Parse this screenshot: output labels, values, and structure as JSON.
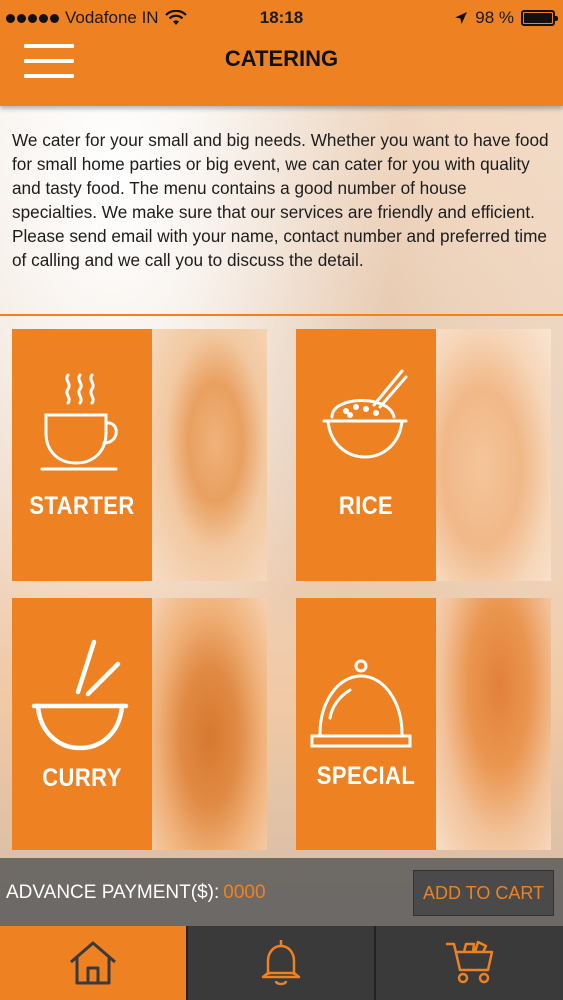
{
  "status_bar": {
    "carrier": "Vodafone IN",
    "time": "18:18",
    "battery": "98 %"
  },
  "header": {
    "title": "CATERING",
    "menu_icon": "hamburger-icon"
  },
  "intro_text": "We cater for your small and big needs. Whether you want to have food for small home parties or big event, we can cater for you with quality and tasty food. The menu contains a good number of house specialties. We make sure that our services are friendly and efficient. Please send email with your name, contact number and preferred time of calling and we call you to discuss the detail.",
  "categories": [
    {
      "label": "STARTER",
      "icon": "coffee-cup-icon"
    },
    {
      "label": "RICE",
      "icon": "rice-bowl-icon"
    },
    {
      "label": "CURRY",
      "icon": "noodle-bowl-icon"
    },
    {
      "label": "SPECIAL",
      "icon": "cloche-icon"
    }
  ],
  "payment": {
    "label": "ADVANCE PAYMENT($):",
    "placeholder": "0000"
  },
  "cart_button": "ADD TO CART",
  "tabs": [
    {
      "icon": "home-icon",
      "active": true
    },
    {
      "icon": "bell-icon",
      "active": false
    },
    {
      "icon": "cart-icon",
      "active": false
    }
  ],
  "colors": {
    "accent": "#ee8222",
    "tabbar": "#3a3a3a"
  }
}
